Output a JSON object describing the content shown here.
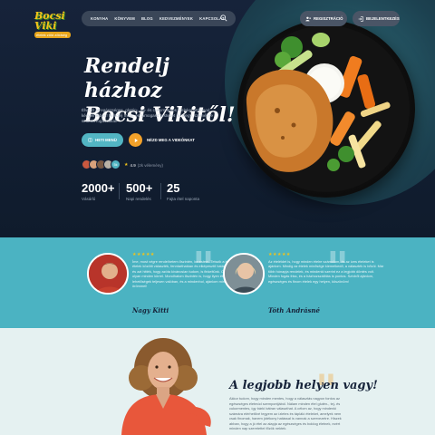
{
  "logo": {
    "main": "Bocsi Viki",
    "sub": "ételek zöld zöldség"
  },
  "nav": {
    "items": [
      "KONYHA",
      "KÖNYVEM",
      "BLOG",
      "KEDVEZMÉNYEK",
      "KAPCSOLAT"
    ]
  },
  "header": {
    "register": "REGISZTRÁCIÓ",
    "login": "BEJELENTKEZÉS"
  },
  "hero": {
    "title_line1": "Rendelj házhoz",
    "title_line2": "Bocsi Vikitől!",
    "lead": "Élvezd az egészséges, glutén-, tej- és cukormentes ételeket otthonod kényelmében! Rendelj most, és támogasd testedet mindegy, személyre szabott fogásokkal!",
    "menu_button": "HETI MENÜ",
    "video_label": "NÉZD MEG A VIDEÓNKAT",
    "avatars_more": "5k",
    "rating_value": "4.9",
    "rating_count": "(2k vélemény)"
  },
  "stats": [
    {
      "value": "2000+",
      "label": "Vásárló"
    },
    {
      "value": "500+",
      "label": "Napi rendelés"
    },
    {
      "value": "25",
      "label": "Fajta étel naponta"
    }
  ],
  "testimonials": [
    {
      "stars": "★★★★★",
      "text": "Íme, most végre rendelhetem őszintén, kerestem. Tetszik a hihetetlen ételek közötti választék, fenntarthatóan és elképesztő hatása az ételeknek, és azt hitték, hogy azóta kíváncsian tudom, is finkeltünk. Olyan sütik teszik, olyan minden körrel. Mondhatom őszintén is, hogy ilyen étellel, a lehetőségek teljesen valóban, és a mindenhol, ajánlom mindenkinek örömmel!",
      "name": "Nagy Kitti"
    },
    {
      "stars": "★★★★★",
      "text": "Az ételéidet is, hogy minden ételre számolom, és az ízes ételeket is ajánlom. Mindig az ételek minősége kiemelkedő, a választék is bővül. Már több hónapja rendelek, és mindenki szerint ez a legjobb döntés volt. Minden fogás friss, és a házhozszállítás is pontos. Szívből ajánlom, egészséges és finom ételek egy helyen, köszönöm!",
      "name": "Tóth Andrásné"
    }
  ],
  "about": {
    "title": "A legjobb helyen vagy!",
    "text": "Akkor tudom, hogy minden mentes, hogy a választás nagyon fontos az egészséges életmód szempontjából. Nálam minden étel glutén-, tej- és cukormentes, így bárki bátran választhat. A célom az, hogy mindenki számára elérhetővé tegyem az ízletes és tápláló ételeket, amelyek nem csak finomak, hanem jótékony hatással is vannak a szervezetre. Hiszek abban, hogy a jó étel az alapja az egészséges és boldog életnek, ezért minden nap szeretettel főzök nektek."
  }
}
